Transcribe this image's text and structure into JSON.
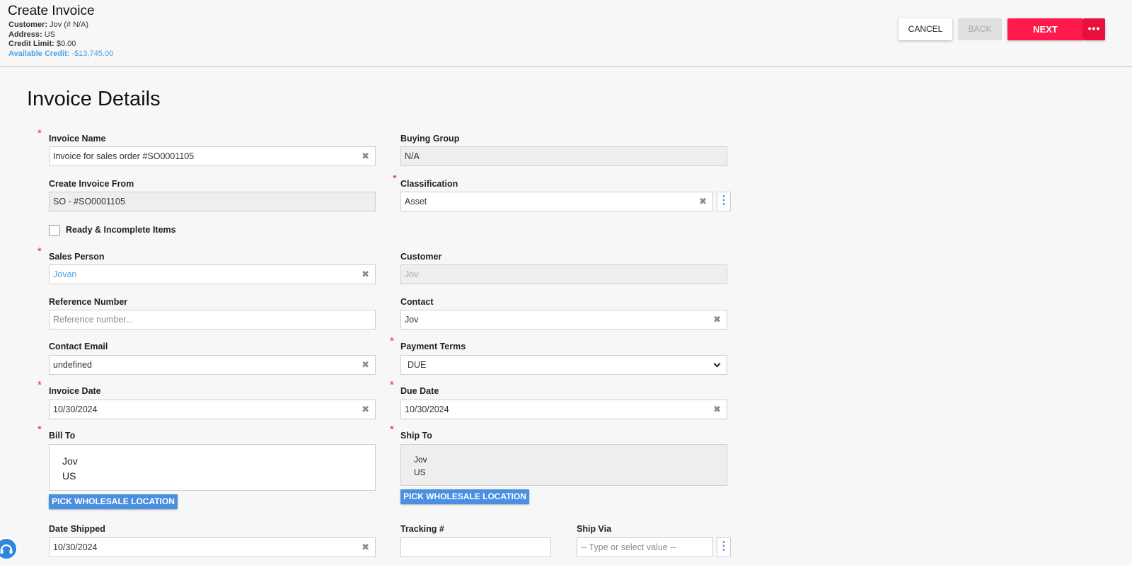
{
  "header": {
    "title": "Create Invoice",
    "customer_label": "Customer:",
    "customer_value": "Jov (# N/A)",
    "address_label": "Address:",
    "address_value": "US",
    "credit_limit_label": "Credit Limit:",
    "credit_limit_value": "$0.00",
    "available_credit_label": "Available Credit:",
    "available_credit_value": "-$13,745.00"
  },
  "actions": {
    "cancel": "CANCEL",
    "back": "BACK",
    "next": "NEXT",
    "more": "•••"
  },
  "page_title": "Invoice Details",
  "form": {
    "invoice_name": {
      "label": "Invoice Name",
      "value": "Invoice for sales order #SO0001105"
    },
    "buying_group": {
      "label": "Buying Group",
      "value": "N/A"
    },
    "create_from": {
      "label": "Create Invoice From",
      "value": "SO - #SO0001105"
    },
    "classification": {
      "label": "Classification",
      "value": "Asset"
    },
    "ready_items": {
      "label": "Ready & Incomplete Items",
      "checked": false
    },
    "sales_person": {
      "label": "Sales Person",
      "value": "Jovan"
    },
    "customer": {
      "label": "Customer",
      "value": "Jov"
    },
    "reference_number": {
      "label": "Reference Number",
      "placeholder": "Reference number..."
    },
    "contact": {
      "label": "Contact",
      "value": "Jov"
    },
    "contact_email": {
      "label": "Contact Email",
      "value": "undefined"
    },
    "payment_terms": {
      "label": "Payment Terms",
      "value": "DUE"
    },
    "invoice_date": {
      "label": "Invoice Date",
      "value": "10/30/2024"
    },
    "due_date": {
      "label": "Due Date",
      "value": "10/30/2024"
    },
    "bill_to": {
      "label": "Bill To",
      "line1": "Jov",
      "line2": "US",
      "button": "PICK WHOLESALE LOCATION"
    },
    "ship_to": {
      "label": "Ship To",
      "line1": "Jov",
      "line2": "US",
      "button": "PICK WHOLESALE LOCATION"
    },
    "date_shipped": {
      "label": "Date Shipped",
      "value": "10/30/2024"
    },
    "tracking": {
      "label": "Tracking #",
      "value": ""
    },
    "ship_via": {
      "label": "Ship Via",
      "placeholder": "-- Type or select value --"
    }
  },
  "icons": {
    "clear": "✖",
    "kebab": "⋮"
  },
  "colors": {
    "primary": "#ff1a4b",
    "link": "#4aa3e8",
    "button_blue": "#4a90e2",
    "required": "#d32f2f"
  }
}
